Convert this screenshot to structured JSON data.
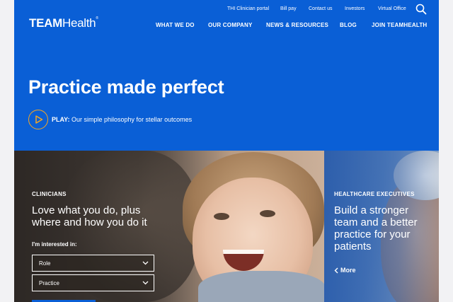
{
  "brand": {
    "logo_bold": "TEAM",
    "logo_regular": "Health",
    "trademark": "®"
  },
  "utility_nav": [
    "THI Clinician portal",
    "Bill pay",
    "Contact us",
    "Investors",
    "Virtual Office"
  ],
  "main_nav": [
    "WHAT WE DO",
    "OUR COMPANY",
    "NEWS & RESOURCES",
    "BLOG",
    "JOIN TEAMHEALTH"
  ],
  "hero": {
    "headline": "Practice made perfect",
    "play_label": "PLAY:",
    "play_text": " Our simple philosophy for stellar outcomes"
  },
  "clinicians": {
    "eyebrow": "CLINICIANS",
    "title_line1": "Love what you do, plus",
    "title_line2": "where and how you do it",
    "interest_label": "I'm interested in:",
    "select_role": "Role",
    "select_practice": "Practice"
  },
  "executives": {
    "eyebrow": "HEALTHCARE EXECUTIVES",
    "title_line1": "Build a stronger",
    "title_line2": "team and a better",
    "title_line3": "practice for your",
    "title_line4": "patients",
    "more_label": "More"
  },
  "colors": {
    "brand_blue": "#0a5fd6",
    "accent_orange": "#f5a623",
    "white": "#ffffff"
  },
  "icons": {
    "search": "search-icon",
    "play": "play-icon",
    "chevron": "chevron-down-icon",
    "chevron_left": "chevron-left-icon"
  }
}
